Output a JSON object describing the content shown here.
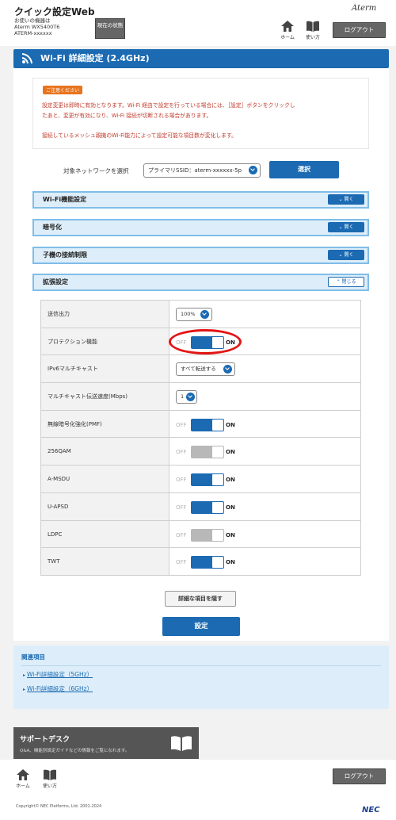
{
  "header": {
    "app_title": "クイック設定Web",
    "device_lines": [
      "お使いの機器は",
      "Aterm WX5400T6",
      "ATERM-xxxxxx"
    ],
    "status_button": "現在の状態",
    "brand": "Aterm",
    "nav": [
      {
        "label": "ホーム",
        "icon": "home-icon"
      },
      {
        "label": "使い方",
        "icon": "book-icon"
      }
    ],
    "logout": "ログアウト"
  },
  "page": {
    "title": "Wi-Fi 詳細設定 (2.4GHz)"
  },
  "notice": {
    "badge": "ご注意ください",
    "text1a": "設定変更は即時に有効となります。Wi-Fi 経由で設定を行っている場合には、［設定］ボタンをクリックし",
    "text1b": "たあと、変更が有効になり、Wi-Fi 接続が切断される場合があります。",
    "text2": "接続しているメッシュ親機のWi-Fi能力によって設定可能な項目数が変化します。"
  },
  "network": {
    "label": "対象ネットワークを選択",
    "selected": "プライマリSSID：aterm-xxxxxx-5p",
    "select_button": "選択"
  },
  "accordions": [
    {
      "title": "Wi-Fi機能設定",
      "toggle": "開く"
    },
    {
      "title": "暗号化",
      "toggle": "開く"
    },
    {
      "title": "子機の接続制限",
      "toggle": "開く"
    },
    {
      "title": "拡張設定",
      "toggle": "閉じる"
    }
  ],
  "settings": {
    "off_label": "OFF",
    "on_label": "ON",
    "rows": [
      {
        "label": "送信出力",
        "type": "select",
        "value": "100%"
      },
      {
        "label": "プロテクション機能",
        "type": "switch",
        "on": true
      },
      {
        "label": "IPv6マルチキャスト",
        "type": "select",
        "value": "すべて転送する"
      },
      {
        "label": "マルチキャスト伝送速度(Mbps)",
        "type": "select",
        "value": "1"
      },
      {
        "label": "無線暗号化強化(PMF)",
        "type": "switch",
        "on": true
      },
      {
        "label": "256QAM",
        "type": "switch",
        "on": false
      },
      {
        "label": "A-MSDU",
        "type": "switch",
        "on": true
      },
      {
        "label": "U-APSD",
        "type": "switch",
        "on": true
      },
      {
        "label": "LDPC",
        "type": "switch",
        "on": false
      },
      {
        "label": "TWT",
        "type": "switch",
        "on": true
      }
    ]
  },
  "buttons": {
    "hide_details": "詳細な項目を隠す",
    "apply": "設定"
  },
  "related": {
    "heading": "関連項目",
    "links": [
      "Wi-Fi詳細設定（5GHz）",
      "Wi-Fi詳細設定（6GHz）"
    ]
  },
  "support": {
    "title": "サポートデスク",
    "subtitle": "Q&A、機能別設定ガイドなどの情報をご覧になれます。"
  },
  "footer": {
    "copyright": "Copyright© NEC Platforms, Ltd. 2001-2024",
    "logo": "NEC"
  }
}
